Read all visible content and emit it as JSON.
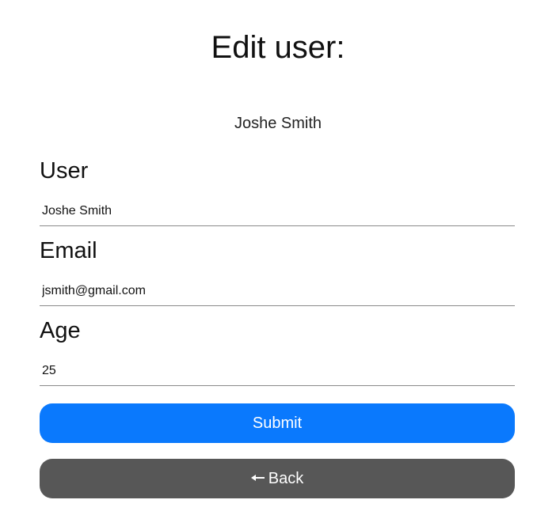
{
  "header": {
    "title": "Edit user:"
  },
  "user_display_name": "Joshe Smith",
  "form": {
    "fields": [
      {
        "label": "User",
        "value": "Joshe Smith"
      },
      {
        "label": "Email",
        "value": "jsmith@gmail.com"
      },
      {
        "label": "Age",
        "value": "25"
      }
    ],
    "submit_label": "Submit",
    "back_label": "Back",
    "back_icon": "left-arrow-icon"
  },
  "colors": {
    "submit_button": "#0a79fd",
    "back_button": "#575757",
    "underline": "#8a8a8a",
    "background": "#ffffff"
  }
}
